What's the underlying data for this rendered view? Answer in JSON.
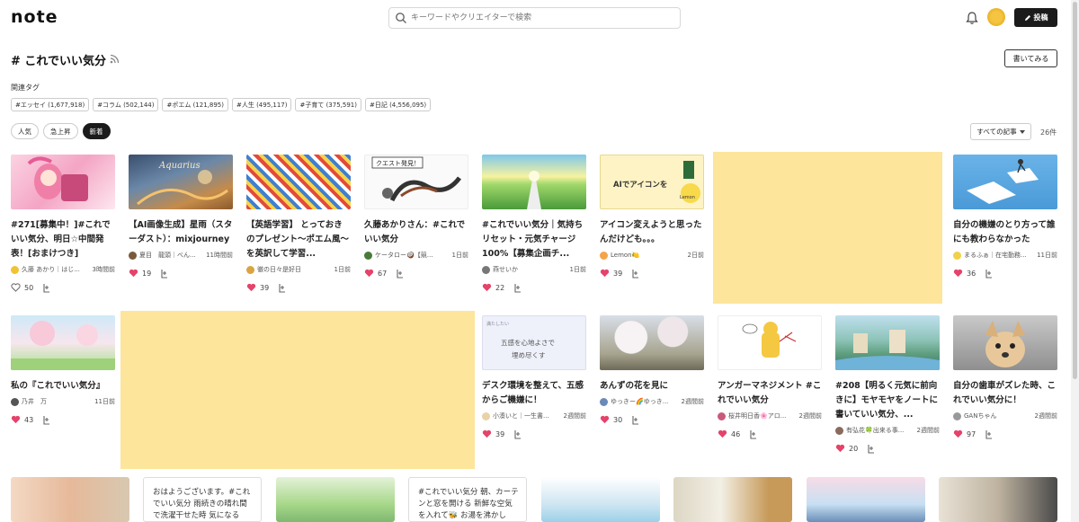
{
  "header": {
    "logo": "note",
    "search_placeholder": "キーワードやクリエイターで検索",
    "post_label": "投稿"
  },
  "page": {
    "title": "# これでいい気分",
    "write_label": "書いてみる",
    "related_label": "関連タグ",
    "tags": [
      "#エッセイ (1,677,918)",
      "#コラム (502,144)",
      "#ポエム (121,895)",
      "#人生 (495,117)",
      "#子育て (375,591)",
      "#日記 (4,556,095)"
    ],
    "sorts": [
      "人気",
      "急上昇",
      "新着"
    ],
    "filter_label": "すべての記事",
    "count": "26件"
  },
  "cards": [
    {
      "title": "#271[募集中！]#これでいい気分、明日☆中間発表！[おまけつき]",
      "author": "久藤 あかり｜はじ...",
      "time": "3時間前",
      "likes": "50",
      "liked": false
    },
    {
      "title": "【AI画像生成】星雨（スターダスト）：mixjourney",
      "author": "夏目　龍頭｜べん...",
      "time": "11時間前",
      "likes": "19",
      "liked": true
    },
    {
      "title": "【英語学習】 とっておきのプレゼント〜ポエム風〜 を英訳して学習...",
      "author": "徹の日々是好日",
      "time": "1日前",
      "likes": "39",
      "liked": true
    },
    {
      "title": "久藤あかりさん：#これでいい気分",
      "author": "ケータロー🥥【競う...",
      "time": "1日前",
      "likes": "67",
      "liked": true
    },
    {
      "title": "#これでいい気分｜気持ちリセット・元気チャージ100%【募集企画チ...",
      "author": "燕せいか",
      "time": "1日前",
      "likes": "22",
      "liked": true
    },
    {
      "title": "アイコン変えようと思ったんだけども。。。",
      "author": "Lemon🍋",
      "time": "2日前",
      "likes": "39",
      "liked": true
    },
    {
      "title": "自分の機嫌のとり方って誰にも教わらなかった",
      "author": "まるふぁ｜在宅勤務...",
      "time": "11日前",
      "likes": "36",
      "liked": true
    },
    {
      "title": "私の『これでいい気分』",
      "author": "乃井　万",
      "time": "11日前",
      "likes": "43",
      "liked": true
    },
    {
      "title": "デスク環境を整えて、五感からご機嫌に！",
      "author": "小湊いと｜一生書...",
      "time": "2週間前",
      "likes": "39",
      "liked": true
    },
    {
      "title": "あんずの花を見に",
      "author": "ゆっきー🌈ゆっき...",
      "time": "2週間前",
      "likes": "30",
      "liked": true
    },
    {
      "title": "アンガーマネジメント #これでいい気分",
      "author": "桜井明日香🌸アロ...",
      "time": "2週間前",
      "likes": "46",
      "liked": true
    },
    {
      "title": "#208【明るく元気に前向きに】モヤモヤをノートに書いていい気分、...",
      "author": "有弘花🍀出来る事...",
      "time": "2週間前",
      "likes": "20",
      "liked": true
    },
    {
      "title": "自分の歯車がズレた時、これでいい気分に！",
      "author": "GANちゃん",
      "time": "2週間前",
      "likes": "97",
      "liked": true
    }
  ],
  "thumb_texts": {
    "aquarius": "Aquarius",
    "lemon": "AIでアイコンを",
    "lemon_sub": "Lemon",
    "quest": "クエスト発見！",
    "desk_line1": "五感を心地よさで",
    "desk_line2": "満たしたい",
    "desk_line3": "埋め尽くす"
  },
  "bottom_texts": [
    "おはようございます。#これでいい気分 雨続きの晴れ間で洗濯干せた時 気になる",
    "#これでいい気分 朝、カーテンと窓を開ける 新鮮な空気を入れて🐝 お湯を沸かし"
  ],
  "colors": {
    "like": "#e5436a",
    "ad": "#fde59c",
    "dark": "#1b1b1b"
  }
}
